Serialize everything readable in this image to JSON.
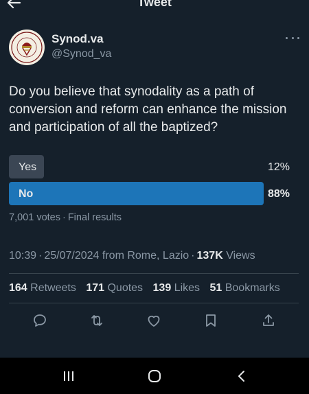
{
  "header": {
    "title": "Tweet",
    "back_icon": "arrow-left-icon"
  },
  "author": {
    "name": "Synod.va",
    "handle": "@Synod_va",
    "avatar_text": "SECRETARIA GENERALIS SYNODI"
  },
  "tweet": {
    "text": "Do you believe that synodality as a path of conversion and reform can enhance the mission and participation of all the baptized?"
  },
  "poll": {
    "options": [
      {
        "label": "Yes",
        "percent": "12%",
        "share": 0.12
      },
      {
        "label": "No",
        "percent": "88%",
        "share": 0.88
      }
    ],
    "votes": "7,001 votes",
    "status": "Final results"
  },
  "meta": {
    "time": "10:39",
    "date": "25/07/2024",
    "location": "from Rome, Lazio",
    "views_count": "137K",
    "views_label": "Views"
  },
  "stats": {
    "retweets_count": "164",
    "retweets_label": "Retweets",
    "quotes_count": "171",
    "quotes_label": "Quotes",
    "likes_count": "139",
    "likes_label": "Likes",
    "bookmarks_count": "51",
    "bookmarks_label": "Bookmarks"
  },
  "actions": [
    "reply-icon",
    "retweet-icon",
    "like-icon",
    "bookmark-icon",
    "share-icon"
  ],
  "colors": {
    "background": "#15202b",
    "accent": "#1d75b8",
    "muted": "#8b98a5",
    "text": "#e7e9ea",
    "nav": "#000000"
  }
}
